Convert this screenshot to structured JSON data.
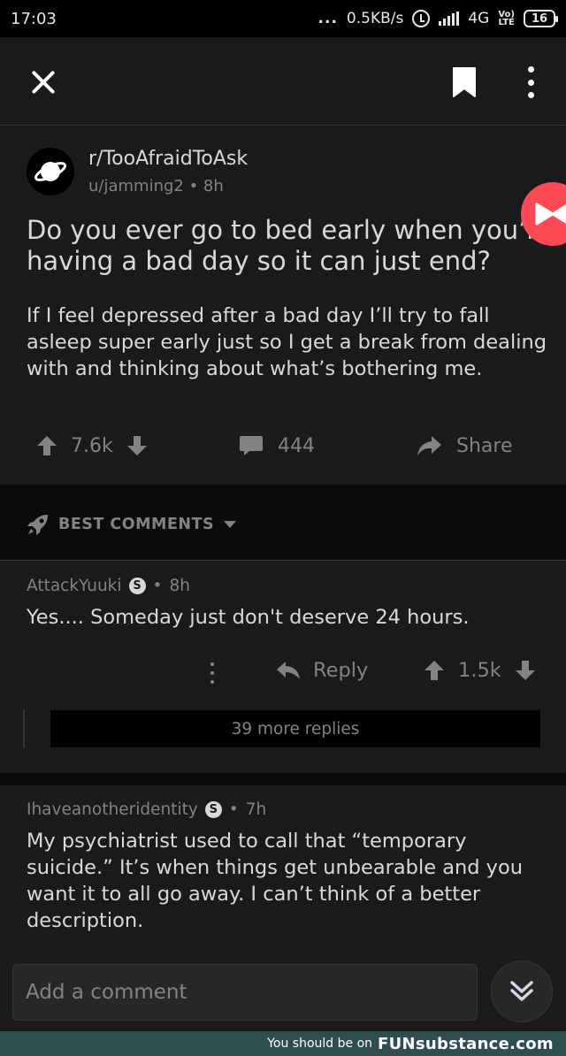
{
  "status_bar": {
    "time": "17:03",
    "dots": "...",
    "net_speed": "0.5KB/s",
    "network": "4G",
    "volte_top": "Vo)",
    "volte_bottom": "LTE",
    "battery": "16"
  },
  "post": {
    "subreddit": "r/TooAfraidToAsk",
    "author": "u/jamming2",
    "age": "8h",
    "title": "Do you ever go to bed early when you’re\nhaving a bad day so it can just end?",
    "body": "If I feel depressed after a bad day I’ll try to fall asleep super early just so I get a break from dealing with and thinking about what’s bothering me.",
    "score": "7.6k",
    "comments_count": "444",
    "share_label": "Share"
  },
  "sort": {
    "label": "BEST COMMENTS"
  },
  "comments": [
    {
      "author": "AttackYuuki",
      "flair": "S",
      "age": "8h",
      "text": "Yes.... Someday just don't deserve 24 hours.",
      "reply_label": "Reply",
      "score": "1.5k",
      "more_replies": "39 more replies"
    },
    {
      "author": "Ihaveanotheridentity",
      "flair": "S",
      "age": "7h",
      "text": "My psychiatrist used to call that “temporary suicide.” It’s when things get unbearable and you want it to all go away. I can’t think of a better description."
    }
  ],
  "composer": {
    "placeholder": "Add a comment"
  },
  "footer": {
    "text": "You should be on",
    "brand": "FUNsubstance.com"
  },
  "colors": {
    "background": "#1a1a1b",
    "text": "#d7dadc",
    "muted": "#818384",
    "badge": "#ff4a55",
    "footer": "#2e4d4c"
  }
}
